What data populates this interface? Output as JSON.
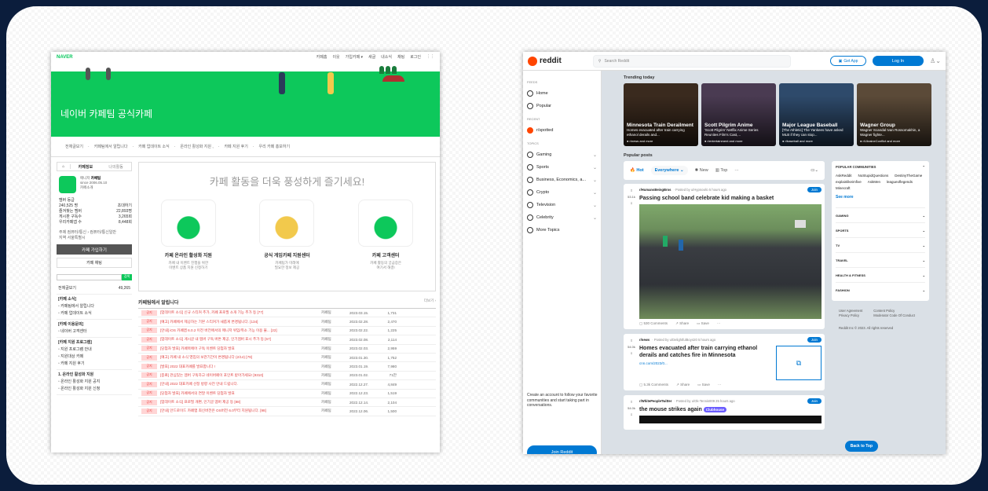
{
  "naver": {
    "logo": "NAVER",
    "top_links": [
      "카페홈",
      "이웃",
      "가입카페 ▾",
      "새글",
      "내소식",
      "채팅",
      "로그인",
      "⋮⋮"
    ],
    "banner_title": "네이버 카페팀 공식카페",
    "menu": [
      "전체글보기",
      "카페팀에서 알립니다",
      "카페 업데이트 소식",
      "온라인 활성화 지원 ,",
      "카페 지원 후기",
      "우리 카페 홍보하기"
    ],
    "tabs": [
      "카페정보",
      "나의활동"
    ],
    "cafe_manager": "매니저",
    "cafe_name": "카페팀",
    "cafe_since": "since 2006.05.10",
    "cafe_intro": "카페소개",
    "stats": [
      {
        "k": "멤버 등급",
        "v": ""
      },
      {
        "k": "240,525 명",
        "v": "초대하기"
      },
      {
        "k": "즐겨찾는 멤버",
        "v": "22,893명"
      },
      {
        "k": "게시판 구독수",
        "v": "3,265회"
      },
      {
        "k": "우리카페앱 수",
        "v": "8,448회"
      }
    ],
    "topic": "주제 컴퓨터/통신 › 컴퓨터/통신일반",
    "region": "지역 서울특별시",
    "join_button": "카페 가입하기",
    "chat_button": "카페 채팅",
    "search_btn": "검색",
    "all_posts": "전체글보기",
    "all_posts_count": "49,265",
    "sections": [
      {
        "title": "[카페 소식]",
        "items": [
          "카페팀에서 알립니다",
          "카페 업데이트 소식"
        ]
      },
      {
        "title": "[카페 이용문의]",
        "items": [
          "네이버 고객센터"
        ]
      },
      {
        "title": "[카페 지원 프로그램]",
        "items": [
          "지원 프로그램 안내",
          "지원대상 카페",
          "카페 지원 후기"
        ]
      },
      {
        "title": "1. 온라인 활성화 지원",
        "items": [
          "온라인 활성화 지원 공지",
          "온라인 활성화 지원 신청"
        ]
      }
    ],
    "promo_title": "카페 활동을 더욱 풍성하게 즐기세요!",
    "cards": [
      {
        "title": "카페 온라인 활성화 지원",
        "desc": "카페 내 이벤트 진행을 위한\n이벤트 상품 지원 신청하기"
      },
      {
        "title": "공식 게임카페 지원센터",
        "desc": "카페팀가 미래에\n필요한 정보 제공"
      },
      {
        "title": "카페 고객센터",
        "desc": "카페 활동의 궁금증은\n여기서 해결!"
      }
    ],
    "board_title": "카페팀에서 알립니다",
    "board_more": "더보기 ›",
    "rows": [
      {
        "tag": "공지",
        "title": "[업데이트 소식] 신규 스티커 추가, 카페 프로필 소개 기능 추가 등 [77]",
        "author": "카페팀",
        "date": "2023.03.15.",
        "views": "1,731"
      },
      {
        "tag": "공지",
        "title": "[예고] 카페에서 제공하는 기본 스티커가 새롭게 변경됩니다. [134]",
        "author": "카페팀",
        "date": "2023.02.28.",
        "views": "2,470"
      },
      {
        "tag": "공지",
        "title": "[안내] iOS 카페앱 6.0.2 이전 버전에서의 매니저 위임/취소 기능 이용 불... [22]",
        "author": "카페팀",
        "date": "2023.02.22.",
        "views": "1,225"
      },
      {
        "tag": "공지",
        "title": "[업데이트 소식] 게시글 내 멤버 구독 버튼 제공, 인기멤버 표시 추가 등 [57]",
        "author": "카페팀",
        "date": "2023.02.08.",
        "views": "2,114"
      },
      {
        "tag": "공지",
        "title": "[당첨자 발표] 카페북에어 구독 이벤트 당첨자 발표",
        "author": "카페팀",
        "date": "2023.02.03.",
        "views": "2,959"
      },
      {
        "tag": "공지",
        "title": "[예고] 카페 내 소식 영입의 보관기간이 변경됩니다 (2/14) [79]",
        "author": "카페팀",
        "date": "2023.01.30.",
        "views": "1,752"
      },
      {
        "tag": "공지",
        "title": "[발표] 2022 대표카페를 발표합니다 !",
        "author": "카페팀",
        "date": "2023.01.19.",
        "views": "7,980"
      },
      {
        "tag": "공지",
        "title": "[종료] 관심있는 멤버 구독하고 네이버페이 포인트 받아가세요! [9310]",
        "author": "카페팀",
        "date": "2023.01.02.",
        "views": "71만"
      },
      {
        "tag": "공지",
        "title": "[안내] 2022 대표카페 선정 방향 사전 안내 드립니다.",
        "author": "카페팀",
        "date": "2022.12.27.",
        "views": "4,849"
      },
      {
        "tag": "공지",
        "title": "[당첨자 발표] 카페에서의 연말 이벤트 당첨자 발표",
        "author": "카페팀",
        "date": "2022.12.23.",
        "views": "1,519"
      },
      {
        "tag": "공지",
        "title": "[업데이트 소식] 프로필 개편, 인기글 멤버 제공 등 [88]",
        "author": "카페팀",
        "date": "2022.12.14.",
        "views": "2,104"
      },
      {
        "tag": "공지",
        "title": "[안내] 안드로이드 카페앱 최신버전은 OS버전 6.0부터 지원됩니다. [98]",
        "author": "카페팀",
        "date": "2022.12.06.",
        "views": "1,500"
      }
    ]
  },
  "reddit": {
    "logo": "reddit",
    "search_placeholder": "Search Reddit",
    "get_app": "Get App",
    "login": "Log In",
    "feeds_label": "FEEDS",
    "feeds": [
      "Home",
      "Popular"
    ],
    "recent_label": "RECENT",
    "recent": [
      "r/spotted"
    ],
    "topics_label": "TOPICS",
    "topics": [
      "Gaming",
      "Sports",
      "Business, Economics, a...",
      "Crypto",
      "Television",
      "Celebrity",
      "More Topics"
    ],
    "create_text": "Create an account to follow your favorite communities and start taking part in conversations.",
    "join": "Join Reddit",
    "trending_title": "Trending today",
    "trending": [
      {
        "title": "Minnesota Train Derailment",
        "sub": "Homes evacuated after train carrying ethanol derails and...",
        "src": "r/news and more",
        "bg": "#3a2a1e"
      },
      {
        "title": "Scott Pilgrim Anime",
        "sub": "'Scott Pilgrim' Netflix Anime Series Reunites Film's Cast,...",
        "src": "r/entertainment and more",
        "bg": "#4a3b52"
      },
      {
        "title": "Major League Baseball",
        "sub": "[The Athletic] The Yankees have asked MLB if they can stop...",
        "src": "r/baseball and more",
        "bg": "#2e4a6b"
      },
      {
        "title": "Wagner Group",
        "sub": "Wagner Scandal Ivan Rossomakhin, a Wagner fighte...",
        "src": "r/UkraineConflict and more",
        "bg": "#5b4a38"
      }
    ],
    "popular_title": "Popular posts",
    "sort": {
      "hot": "Hot",
      "everywhere": "Everywhere ⌄",
      "new": "New",
      "top": "Top",
      "more": "···"
    },
    "posts": [
      {
        "votes": "53.1k",
        "sub": "r/HumansBeingBros",
        "by": "· Posted by u/Hypnovilo 5 hours ago",
        "title": "Passing school band celebrate kid making a basket",
        "comments": "530 Comments",
        "share": "Share",
        "save": "Save"
      },
      {
        "votes": "54.0k",
        "sub": "r/news",
        "by": "· Posted by u/DelightfulBoy420 5 hours ago",
        "title": "Homes evacuated after train carrying ethanol derails and catches fire in Minnesota",
        "link": "cnn.com/2023/0...",
        "comments": "5.3k Comments",
        "share": "Share",
        "save": "Save"
      },
      {
        "votes": "54.0k",
        "sub": "r/WhitePeopleTwitter",
        "by": "· Posted by u/Ok-Tennis009 25 hours ago",
        "title": "the mouse strikes again",
        "flair": "Clubhouse"
      }
    ],
    "join_label": "Join",
    "communities_title": "POPULAR COMMUNITIES",
    "communities": [
      "AskReddit",
      "NoStupidQuestions",
      "DestinyTheGame",
      "explainlikeimfive",
      "AskMen",
      "leagueoflegends",
      "Minecraft"
    ],
    "see_more": "See more",
    "categories": [
      "GAMING",
      "SPORTS",
      "TV",
      "TRAVEL",
      "HEALTH & FITNESS",
      "FASHION"
    ],
    "footer_links_a": [
      "User Agreement",
      "Privacy Policy"
    ],
    "footer_links_b": [
      "Content Policy",
      "Moderator Code Of Conduct"
    ],
    "copyright": "Reddit Inc © 2023. All rights reserved",
    "back_to_top": "Back to Top"
  }
}
